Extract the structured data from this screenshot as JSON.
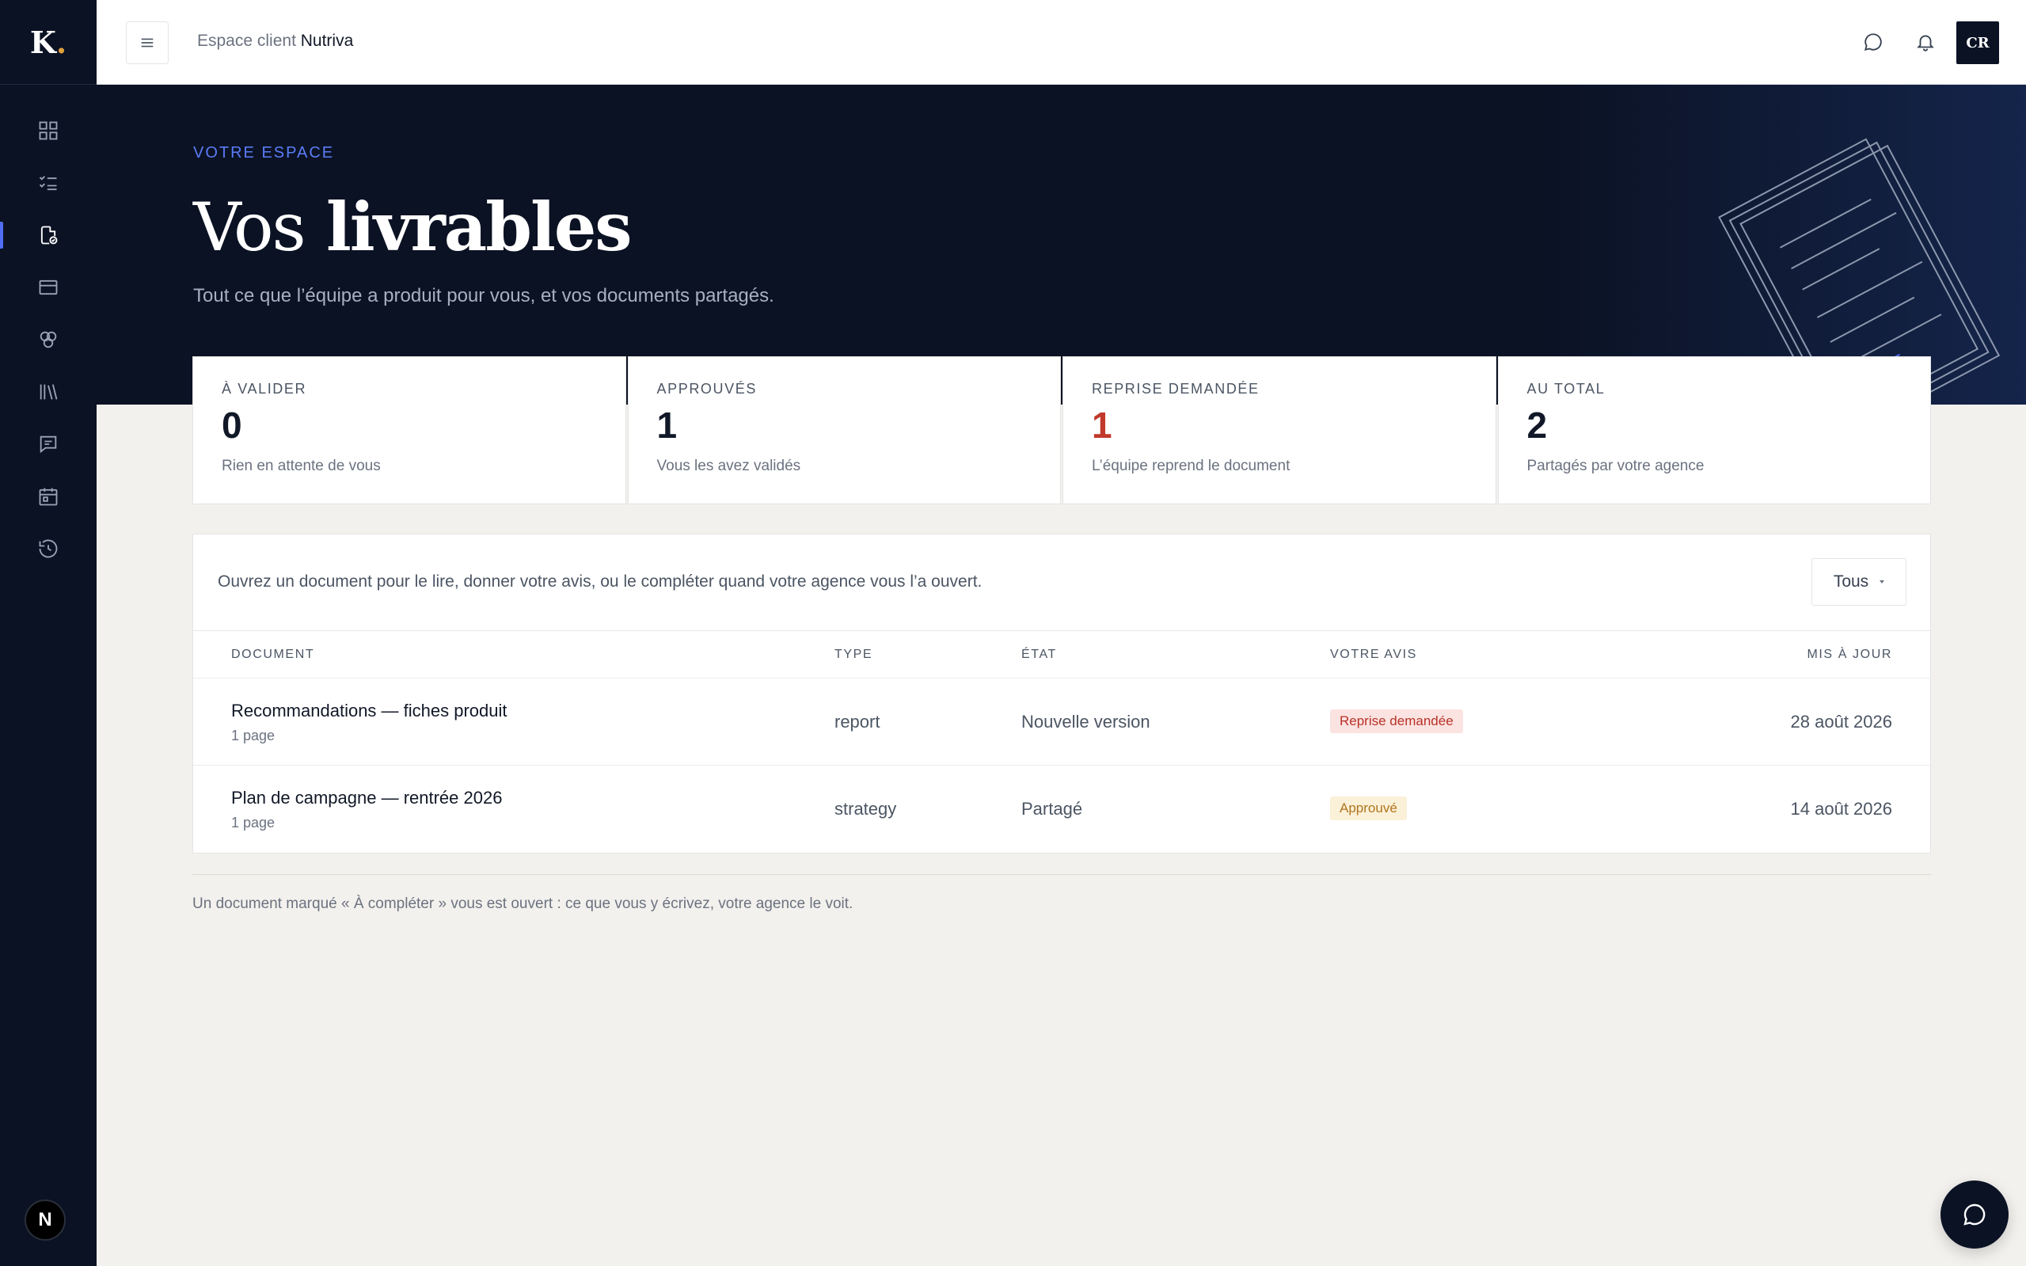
{
  "brand": {
    "logo_letter": "K",
    "logo_dot": ".",
    "dot_color": "#e0a13c"
  },
  "sidebar": {
    "items": [
      {
        "icon": "dashboard-icon",
        "active": false
      },
      {
        "icon": "checklist-icon",
        "active": false
      },
      {
        "icon": "document-check-icon",
        "active": true
      },
      {
        "icon": "card-icon",
        "active": false
      },
      {
        "icon": "circles-icon",
        "active": false
      },
      {
        "icon": "library-icon",
        "active": false
      },
      {
        "icon": "message-icon",
        "active": false
      },
      {
        "icon": "calendar-icon",
        "active": false
      },
      {
        "icon": "history-icon",
        "active": false
      }
    ],
    "bottom_badge": "N"
  },
  "header": {
    "breadcrumb_prefix": "Espace client",
    "breadcrumb_client": "Nutriva",
    "avatar_initials": "CR"
  },
  "hero": {
    "eyebrow": "VOTRE ESPACE",
    "title_light": "Vos",
    "title_bold": "livrables",
    "subtitle": "Tout ce que l’équipe a produit pour vous, et vos documents partagés."
  },
  "stats": [
    {
      "label": "À valider",
      "value": "0",
      "note": "Rien en attente de vous"
    },
    {
      "label": "Approuvés",
      "value": "1",
      "note": "Vous les avez validés"
    },
    {
      "label": "Reprise demandée",
      "value": "1",
      "note": "L’équipe reprend le document"
    },
    {
      "label": "Au total",
      "value": "2",
      "note": "Partagés par votre agence"
    }
  ],
  "panel": {
    "hint": "Ouvrez un document pour le lire, donner votre avis, ou le compléter quand votre agence vous l’a ouvert.",
    "filter_label": "Tous",
    "columns": {
      "document": "Document",
      "type": "Type",
      "state": "État",
      "opinion": "Votre avis",
      "updated": "Mis à jour"
    },
    "rows": [
      {
        "name": "Recommandations — fiches produit",
        "pages": "1 page",
        "type": "report",
        "state": "Nouvelle version",
        "opinion": "Reprise demandée",
        "date": "28 août 2026"
      },
      {
        "name": "Plan de campagne — rentrée 2026",
        "pages": "1 page",
        "type": "strategy",
        "state": "Partagé",
        "opinion": "Approuvé",
        "date": "14 août 2026"
      }
    ]
  },
  "footnote": "Un document marqué « À compléter » vous est ouvert : ce que vous y écrivez, votre agence le voit.",
  "colors": {
    "accent": "#4f6df5",
    "danger": "#c0392b",
    "warning": "#b07620",
    "sidebar_bg": "#0b1224"
  }
}
